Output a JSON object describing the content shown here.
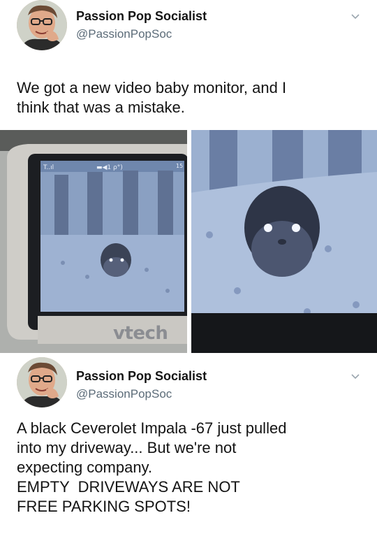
{
  "tweets": [
    {
      "author": {
        "name": "Passion Pop Socialist",
        "handle": "@PassionPopSoc"
      },
      "text_lines": [
        "We got a new video baby monitor, and I",
        "think that was a mistake."
      ],
      "menu_icon": "chevron-down-icon"
    },
    {
      "author": {
        "name": "Passion Pop Socialist",
        "handle": "@PassionPopSoc"
      },
      "text_lines": [
        "A black Ceverolet Impala -67 just pulled",
        "into my driveway... But we're not",
        "expecting company.",
        "EMPTY  DRIVEWAYS ARE NOT",
        "FREE PARKING SPOTS!"
      ],
      "menu_icon": "chevron-down-icon"
    }
  ],
  "media": {
    "brand_text": "vtech",
    "monitor_status": {
      "signal": "T..ıl",
      "indicators": "▬◀1 ρ°)",
      "clock": "15"
    }
  },
  "colors": {
    "name": "#141414",
    "handle": "#5b6b78",
    "monitor_screen": "#7f95b9",
    "monitor_bezel": "#c9c7c2"
  }
}
